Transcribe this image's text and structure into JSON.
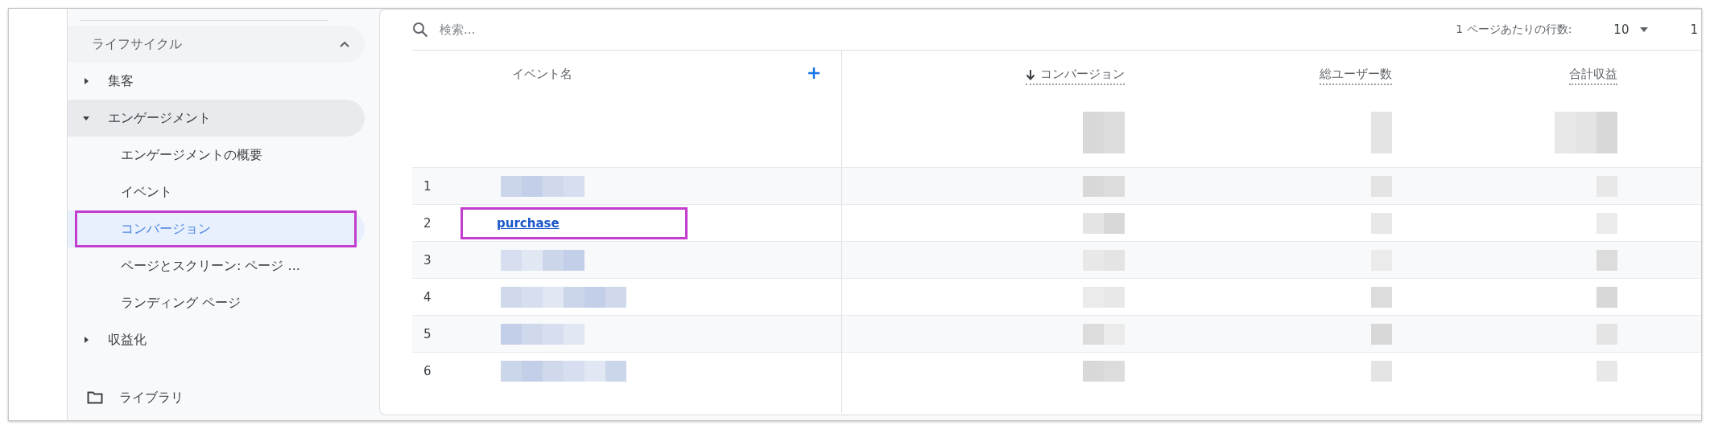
{
  "sidebar": {
    "section": {
      "label": "ライフサイクル",
      "expanded": true
    },
    "items": [
      {
        "label": "集客",
        "expanded": false
      },
      {
        "label": "エンゲージメント",
        "expanded": true,
        "children": [
          {
            "label": "エンゲージメントの概要",
            "selected": false,
            "highlighted": false
          },
          {
            "label": "イベント",
            "selected": false,
            "highlighted": false
          },
          {
            "label": "コンバージョン",
            "selected": true,
            "highlighted": true
          },
          {
            "label": "ページとスクリーン: ページ ...",
            "selected": false,
            "highlighted": false
          },
          {
            "label": "ランディング ページ",
            "selected": false,
            "highlighted": false
          }
        ]
      },
      {
        "label": "収益化",
        "expanded": false
      }
    ],
    "footer": {
      "label": "ライブラリ"
    }
  },
  "table": {
    "search": {
      "placeholder": "検索..."
    },
    "pagination": {
      "label": "1 ページあたりの行数:",
      "rows_per_page": "10",
      "page": "1"
    },
    "columns": [
      {
        "label": "イベント名",
        "kind": "dimension",
        "sorted": false
      },
      {
        "label": "コンバージョン",
        "kind": "metric",
        "sorted": true
      },
      {
        "label": "総ユーザー数",
        "kind": "metric",
        "sorted": false
      },
      {
        "label": "合計収益",
        "kind": "metric",
        "sorted": false
      }
    ],
    "rows": [
      {
        "number": "1",
        "highlighted": false
      },
      {
        "number": "2",
        "event_name": "purchase",
        "highlighted": true
      },
      {
        "number": "3",
        "highlighted": false
      },
      {
        "number": "4",
        "highlighted": false
      },
      {
        "number": "5",
        "highlighted": false
      },
      {
        "number": "6",
        "highlighted": false
      }
    ]
  }
}
